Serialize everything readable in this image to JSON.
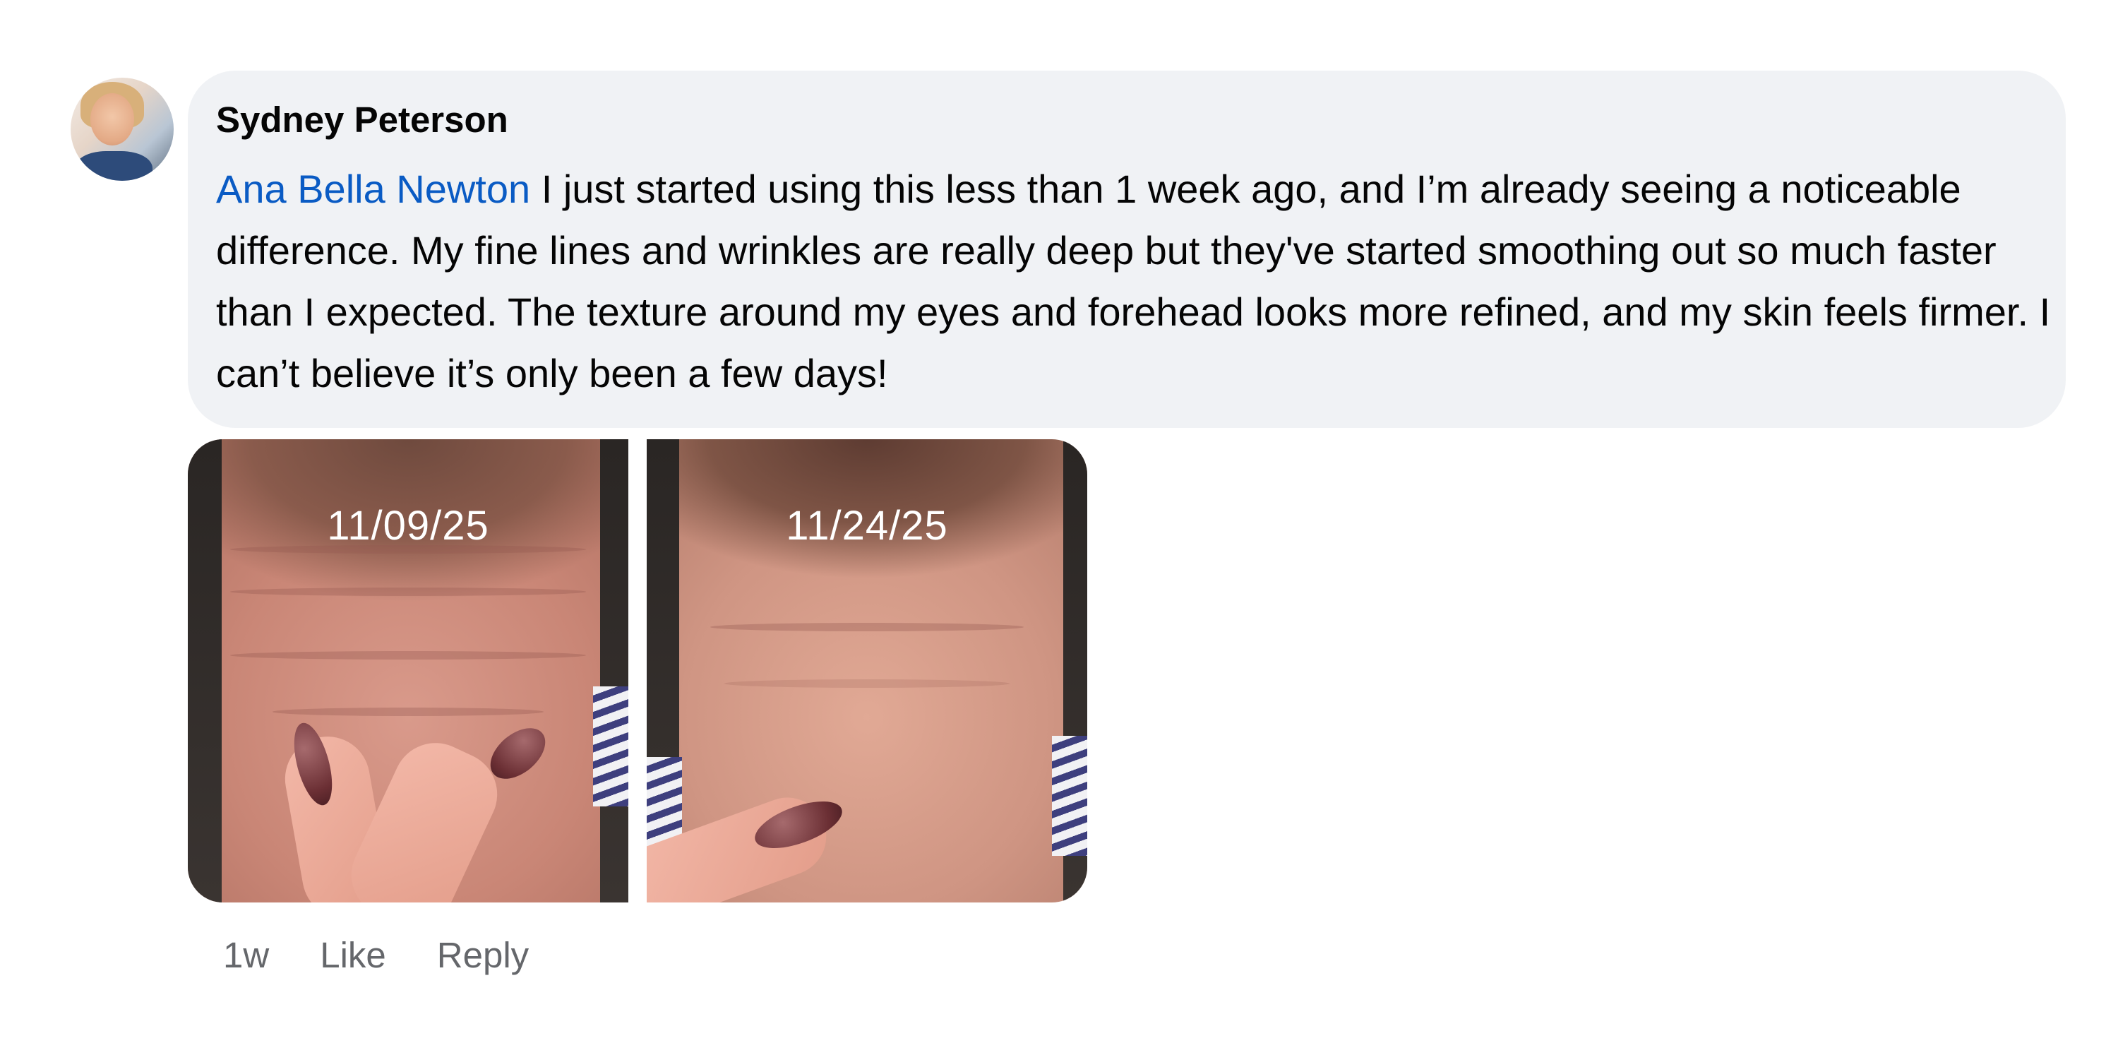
{
  "comment": {
    "author": "Sydney Peterson",
    "mention": "Ana Bella Newton",
    "text": " I just started using this less than 1 week ago, and I’m already seeing a noticeable difference. My fine lines and wrinkles are really deep but they've started smoothing out so much faster than I expected. The texture around my eyes and forehead looks more refined, and my skin feels firmer. I can’t believe it’s only been a few days!",
    "photos": [
      {
        "date_label": "11/09/25"
      },
      {
        "date_label": "11/24/25"
      }
    ],
    "actions": {
      "time": "1w",
      "like": "Like",
      "reply": "Reply"
    }
  },
  "colors": {
    "bubble_background": "#f0f2f5",
    "mention_link": "#0a5bc4",
    "action_text": "#65676b"
  }
}
